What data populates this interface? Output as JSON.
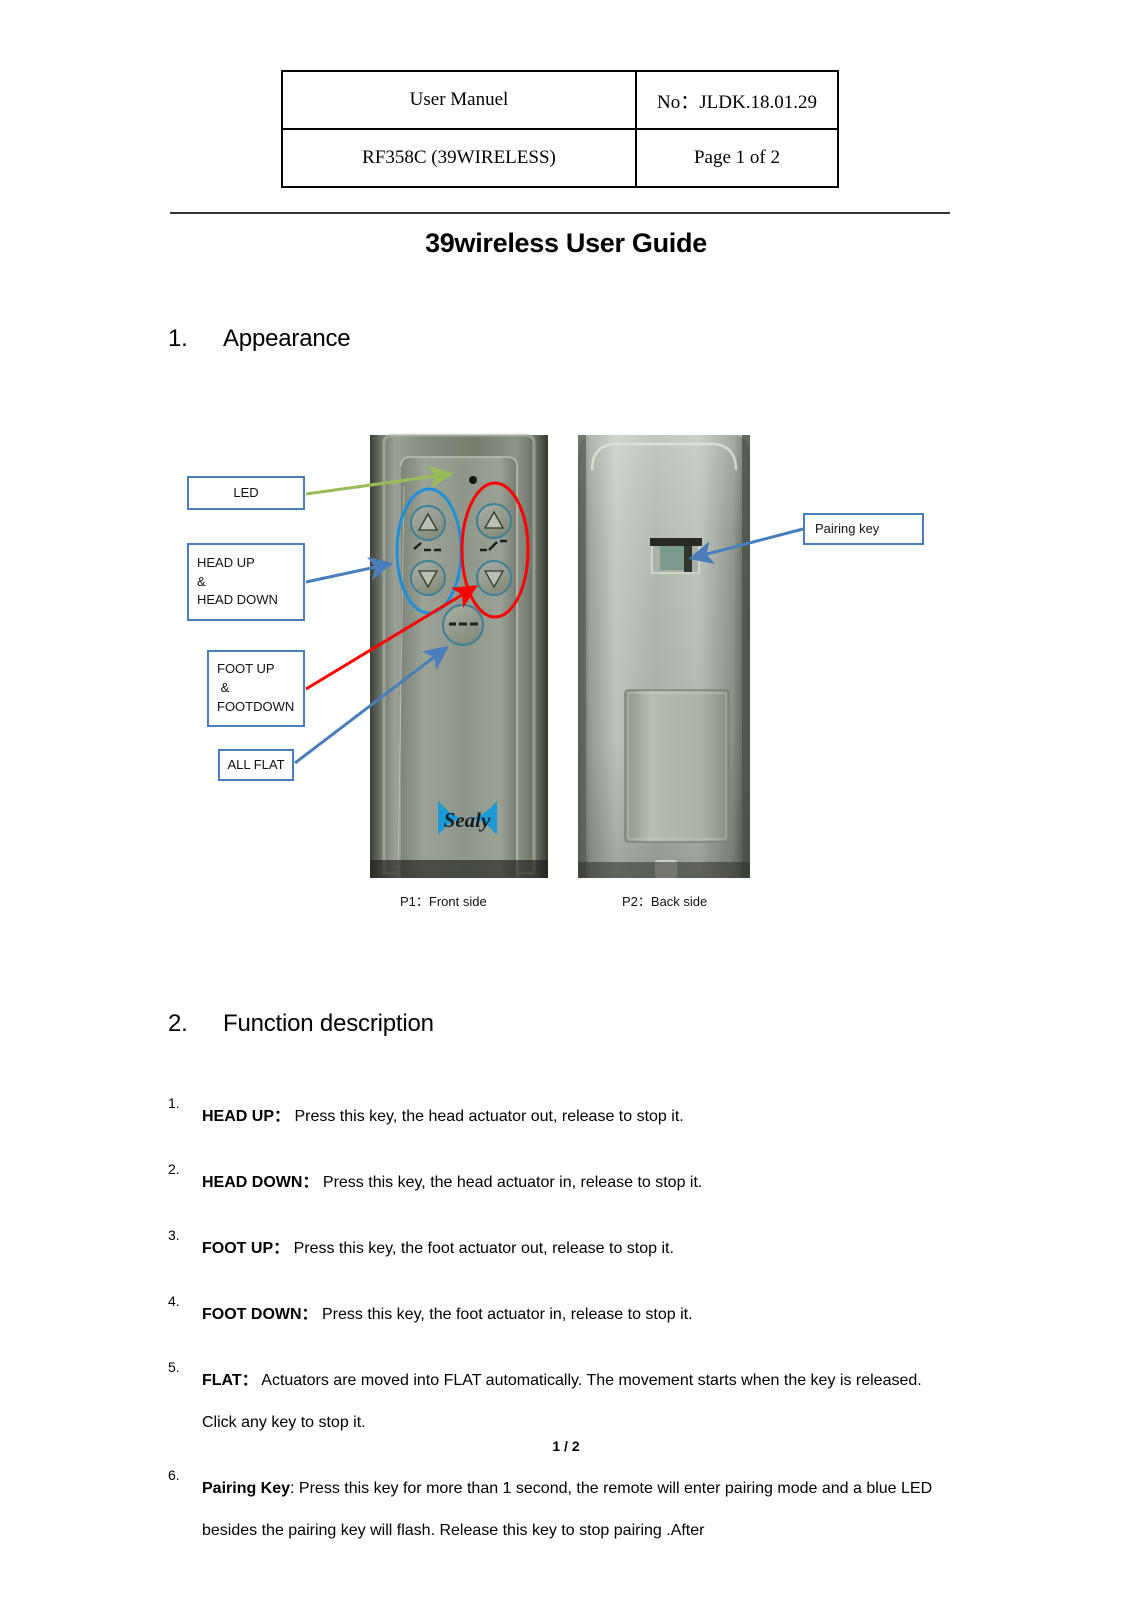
{
  "header_table": {
    "rows": [
      {
        "left": "User Manuel",
        "right": "No：JLDK.18.01.29"
      },
      {
        "left": "RF358C (39WIRELESS)",
        "right": "Page 1 of 2"
      }
    ]
  },
  "doc_title": "39wireless User Guide",
  "sections": [
    {
      "num": "1.",
      "title": "Appearance"
    },
    {
      "num": "2.",
      "title": "Function description"
    }
  ],
  "figure": {
    "callouts": {
      "led": "LED",
      "head": {
        "l1": "HEAD UP",
        "l2": "&",
        "l3": "HEAD DOWN"
      },
      "foot": {
        "l1": "FOOT UP",
        "l2": " &",
        "l3": "FOOTDOWN"
      },
      "flat": "ALL FLAT",
      "pairing": "Pairing key"
    },
    "captions": {
      "p1": "P1：Front side",
      "p2": "P2：Back side"
    },
    "brand": "Sealy",
    "colors": {
      "callout_border": "#4a7ebb",
      "arrow_blue": "#4a7ebb",
      "arrow_green": "#9bbb59",
      "arrow_red": "#ff0000",
      "ellipse_blue": "#1f8fd8",
      "ellipse_red": "#ff0000",
      "brand_blue": "#1b9ad6"
    }
  },
  "function_list": [
    {
      "num": "1.",
      "term": "HEAD UP：",
      "text": "  Press this key, the head actuator out, release to stop it."
    },
    {
      "num": "2.",
      "term": "HEAD DOWN：",
      "text": "  Press this key, the head actuator in, release to stop it."
    },
    {
      "num": "3.",
      "term": "FOOT UP：",
      "text": "  Press this key, the foot actuator out, release to stop it."
    },
    {
      "num": "4.",
      "term": "FOOT DOWN：",
      "text": "  Press this key, the foot actuator in, release to stop it."
    },
    {
      "num": "5.",
      "term": "FLAT：",
      "text": "  Actuators are moved into FLAT automatically. The movement starts when the key is released. Click any key to stop it."
    },
    {
      "num": "6.",
      "term": "Pairing Key",
      "text": ": Press this key for more than 1 second, the remote will enter pairing mode and a blue LED besides the pairing key will   flash. Release this key to stop pairing .After"
    }
  ],
  "page_number": "1 / 2"
}
